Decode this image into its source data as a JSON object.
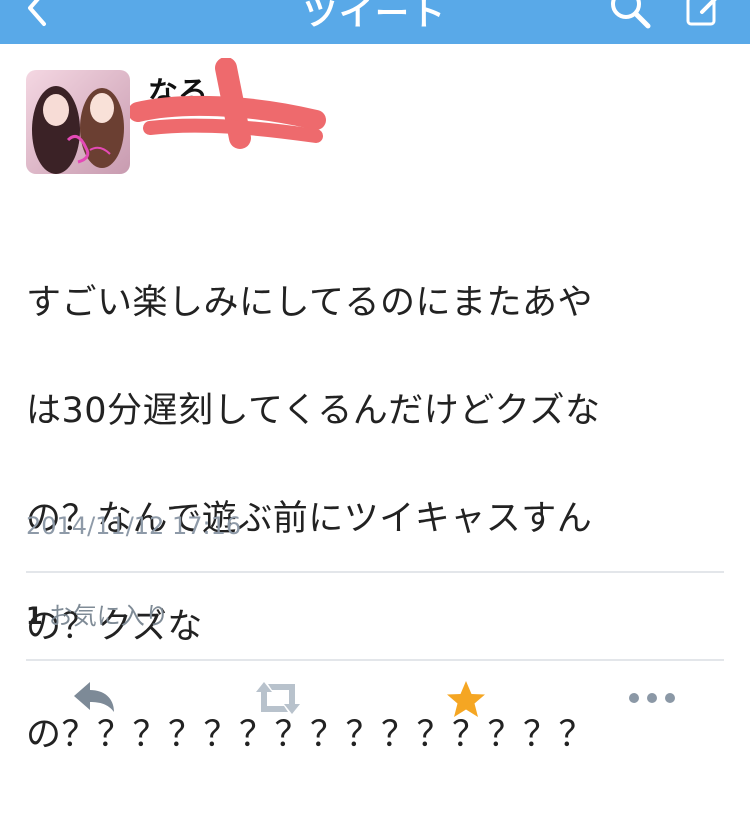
{
  "nav": {
    "title": "ツイート",
    "back_icon": "chevron-left-icon",
    "search_icon": "search-icon",
    "compose_icon": "compose-icon",
    "bar_color": "#59a9e8"
  },
  "tweet": {
    "username": "なる",
    "avatar_icon": "profile-photo",
    "lines": [
      "すごい楽しみにしてるのにまたあや",
      "は30分遅刻してくるんだけどクズな",
      "の？なんで遊ぶ前にツイキャスすん",
      "の？クズな",
      "の？？？？？？？？？？？？？？？"
    ],
    "timestamp": "2014/11/12 17:16",
    "favorite_count": "1",
    "favorite_label": "お気に入り"
  },
  "actions": {
    "reply_icon": "reply-icon",
    "retweet_icon": "retweet-icon",
    "favorite_icon": "star-icon",
    "more_icon": "more-icon",
    "favorite_color": "#f5a623",
    "inactive_color": "#8b98a6"
  }
}
